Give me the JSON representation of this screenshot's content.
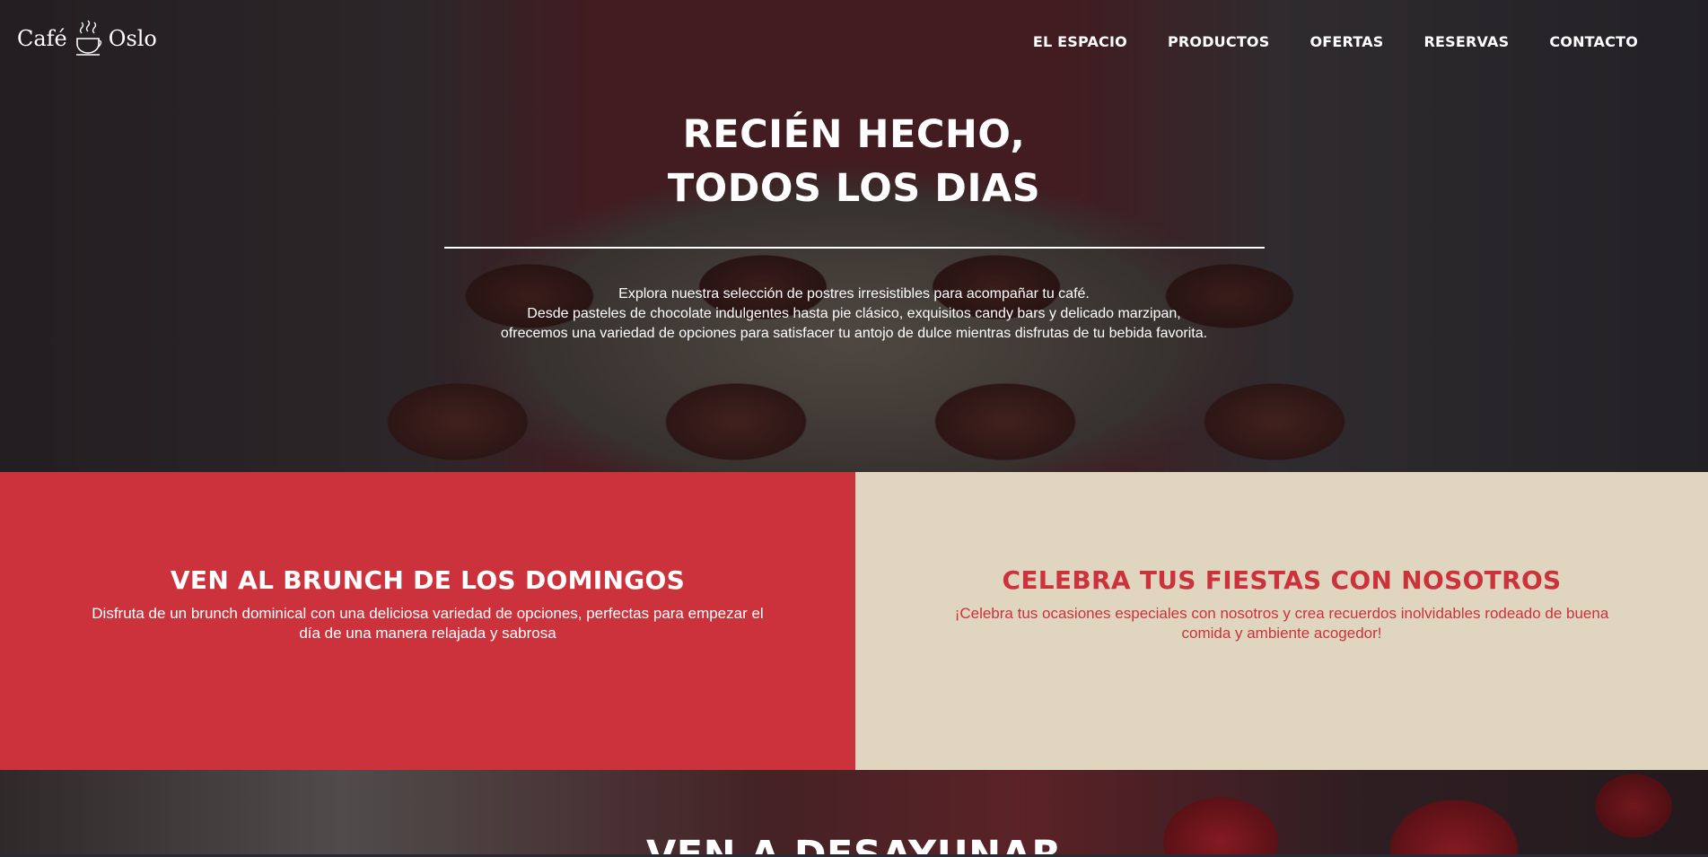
{
  "header": {
    "logo": {
      "left": "Café",
      "right": "Oslo",
      "icon": "coffee-cup-icon"
    },
    "menu": [
      {
        "label": "EL ESPACIO"
      },
      {
        "label": "PRODUCTOS"
      },
      {
        "label": "OFERTAS"
      },
      {
        "label": "RESERVAS"
      },
      {
        "label": "CONTACTO"
      }
    ]
  },
  "hero": {
    "title_line1": "RECIÉN HECHO,",
    "title_line2": "TODOS LOS DIAS",
    "text_line1": "Explora nuestra selección de postres irresistibles para acompañar tu café.",
    "text_line2": "Desde pasteles de chocolate indulgentes hasta pie clásico, exquisitos candy bars y delicado marzipan,",
    "text_line3": "ofrecemos una variedad de opciones para satisfacer tu antojo de dulce mientras disfrutas de tu bebida favorita."
  },
  "panels": [
    {
      "title": "VEN AL BRUNCH DE LOS DOMINGOS",
      "text": "Disfruta de un brunch dominical con una deliciosa variedad de opciones, perfectas para empezar el día de una manera relajada y sabrosa"
    },
    {
      "title": "CELEBRA TUS FIESTAS CON NOSOTROS",
      "text": "¡Celebra tus ocasiones especiales con nosotros y crea recuerdos inolvidables rodeado de buena comida y ambiente acogedor!"
    }
  ],
  "bottom": {
    "title": "VEN A DESAYUNAR"
  },
  "colors": {
    "accent_red": "#cc323c",
    "cream": "#e0d6c0"
  }
}
